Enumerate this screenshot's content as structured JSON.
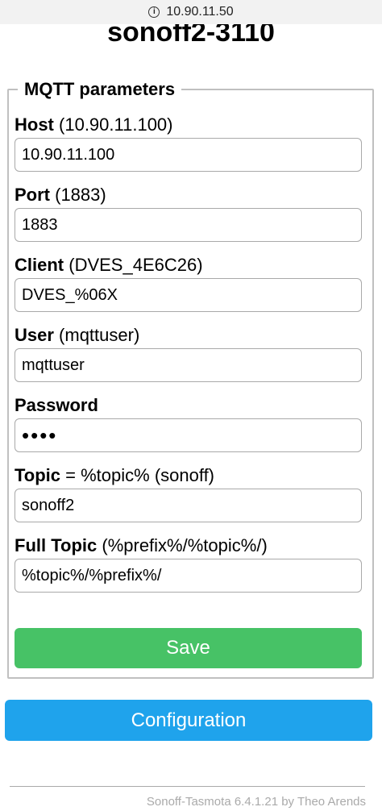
{
  "browser": {
    "url": "10.90.11.50",
    "info_icon": "info-icon"
  },
  "page": {
    "title": "sonoff2-3110"
  },
  "mqtt": {
    "legend": "MQTT parameters",
    "fields": {
      "host": {
        "label": "Host",
        "hint": "(10.90.11.100)",
        "value": "10.90.11.100"
      },
      "port": {
        "label": "Port",
        "hint": "(1883)",
        "value": "1883"
      },
      "client": {
        "label": "Client",
        "hint": "(DVES_4E6C26)",
        "value": "DVES_%06X"
      },
      "user": {
        "label": "User",
        "hint": "(mqttuser)",
        "value": "mqttuser"
      },
      "password": {
        "label": "Password",
        "hint": "",
        "value": "••••"
      },
      "topic": {
        "label": "Topic",
        "hint": "= %topic% (sonoff)",
        "value": "sonoff2"
      },
      "full_topic": {
        "label": "Full Topic",
        "hint": "(%prefix%/%topic%/)",
        "value": "%topic%/%prefix%/"
      }
    },
    "save_label": "Save"
  },
  "nav": {
    "configuration_label": "Configuration"
  },
  "footer": {
    "text": "Sonoff-Tasmota 6.4.1.21 by Theo Arends"
  },
  "colors": {
    "save_button": "#47c266",
    "config_button": "#1fa3ec",
    "fieldset_border": "#c0c0c0",
    "footer_text": "#aaaaaa"
  }
}
